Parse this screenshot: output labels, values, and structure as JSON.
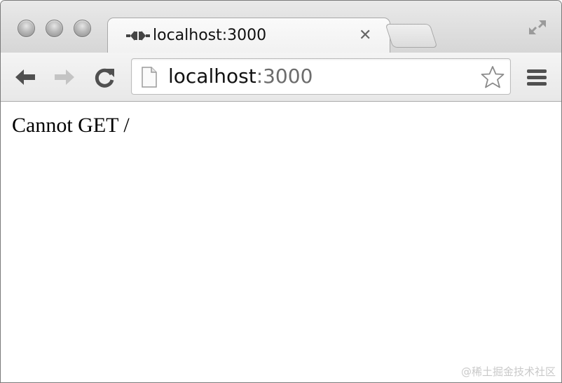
{
  "tab": {
    "title": "localhost:3000",
    "close_glyph": "✕",
    "favicon_icon": "plug-icon"
  },
  "omnibox": {
    "host": "localhost",
    "port": ":3000",
    "page_icon": "page-icon",
    "bookmark_icon": "star-icon"
  },
  "toolbar": {
    "back_icon": "back-arrow-icon",
    "forward_icon": "forward-arrow-icon",
    "reload_icon": "reload-icon",
    "menu_icon": "hamburger-menu-icon"
  },
  "content": {
    "message": "Cannot GET /"
  },
  "watermark": "@稀土掘金技术社区",
  "colors": {
    "window_border": "#7a7a7a",
    "tab_background": "#f6f6f6",
    "toolbar_background": "#eeeeee",
    "port_text": "#6c6c6c",
    "forward_disabled": "#c4c4c4"
  }
}
